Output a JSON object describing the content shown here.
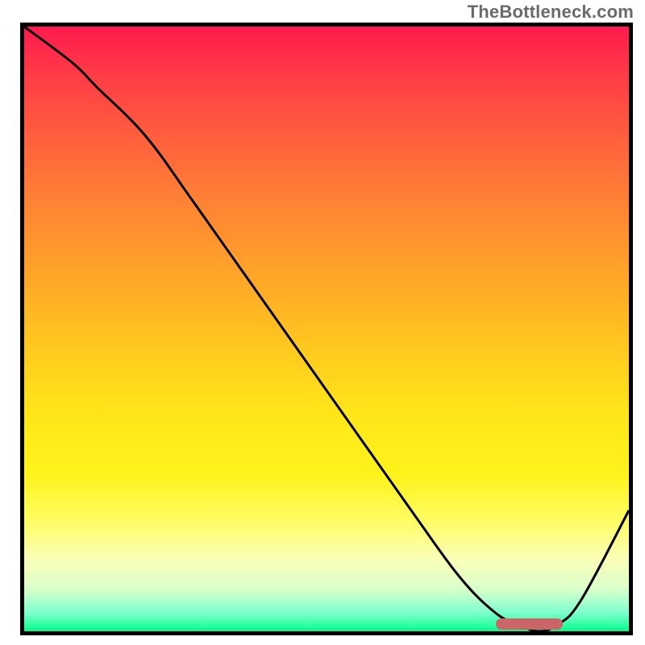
{
  "watermark": "TheBottleneck.com",
  "colors": {
    "gradient_top": "#ff1a4d",
    "gradient_mid_orange": "#ff9a2a",
    "gradient_mid_yellow": "#ffe619",
    "gradient_pale": "#fbffb6",
    "gradient_green": "#22ff9c",
    "curve": "#000000",
    "border": "#000000",
    "trough_marker": "#cc6666",
    "watermark": "#6a6a6a"
  },
  "chart_data": {
    "type": "line",
    "title": "",
    "xlabel": "",
    "ylabel": "",
    "xlim": [
      0,
      100
    ],
    "ylim": [
      0,
      100
    ],
    "x": [
      0,
      8,
      12,
      20,
      28,
      40,
      52,
      64,
      72,
      78,
      82,
      85,
      88,
      92,
      100
    ],
    "values": [
      100,
      94,
      90,
      82,
      71,
      54,
      37,
      20,
      9,
      3,
      1,
      0,
      1,
      5,
      20
    ],
    "trough_marker": {
      "x_start": 78,
      "x_end": 89,
      "y": 0
    },
    "legend": [],
    "annotations": []
  }
}
